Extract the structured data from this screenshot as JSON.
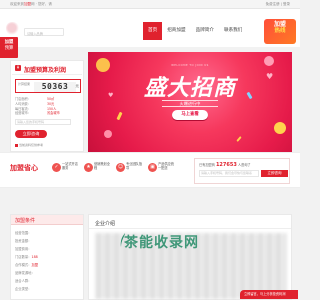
{
  "topbar": {
    "welcome": "欢迎来到",
    "brand_tag": "加盟",
    "welcome_rest": "网 · 您好，请",
    "links": "免费注册 | 登录"
  },
  "header": {
    "search_placeholder": "请输入品牌",
    "nav": [
      "首页",
      "招商加盟",
      "品牌简介",
      "联系我们"
    ],
    "badge_line1": "加盟",
    "badge_line2": "热线"
  },
  "side_float": {
    "title": "加盟",
    "subtitle": "预算"
  },
  "calculator": {
    "title": "加盟预算及利润",
    "result_label": "计算结果",
    "result_value": "50363",
    "result_unit": "元",
    "fields": [
      {
        "k": "门店面积：",
        "v": "50㎡"
      },
      {
        "k": "人均消费：",
        "v": "30元"
      },
      {
        "k": "每日客流：",
        "v": "150人"
      },
      {
        "k": "经营城市：",
        "v": "省会城市"
      }
    ],
    "input_placeholder": "请输入您的手机号码",
    "button_label": "立即咨询",
    "note": "当前资料仅供参考"
  },
  "banner": {
    "topline": "WELCOME TO JOIN US",
    "headline": "盛大招商",
    "sub": "火爆进行中",
    "cta_label": "马上查看"
  },
  "strip": {
    "title": "加盟省心",
    "features": [
      {
        "icon": "shield-icon",
        "glyph": "✓",
        "text": "一站式开店服务"
      },
      {
        "icon": "star-icon",
        "glyph": "★",
        "text": "营销策划全程"
      },
      {
        "icon": "people-icon",
        "glyph": "☺",
        "text": "专业团队指导"
      },
      {
        "icon": "box-icon",
        "glyph": "▣",
        "text": "产品供应统一配送"
      }
    ],
    "lead_text": "已有加盟商",
    "lead_count": "127653",
    "lead_text2": "人咨询了",
    "lead_placeholder": "请输入手机号码，我们会尽快与您联系",
    "lead_button": "立即咨询"
  },
  "left_card": {
    "title": "加盟条件",
    "rows": [
      {
        "k": "经营范围：",
        "v": ""
      },
      {
        "k": "投资金额：",
        "v": ""
      },
      {
        "k": "加盟费用：",
        "v": ""
      },
      {
        "k": "门店数量：",
        "v": "188"
      },
      {
        "k": "合作模式：",
        "v": "加盟"
      },
      {
        "k": "品牌发源地：",
        "v": ""
      },
      {
        "k": "适合人群：",
        "v": ""
      },
      {
        "k": "企业类型：",
        "v": ""
      }
    ]
  },
  "right_card": {
    "title": "企业介绍"
  },
  "watermark": {
    "text": "茶能收录网"
  },
  "float_bar": {
    "text": "立即留言，马上分析投资利润"
  },
  "colors": {
    "accent": "#e0222e",
    "banner": "#f6385d",
    "watermark": "#288c69"
  }
}
